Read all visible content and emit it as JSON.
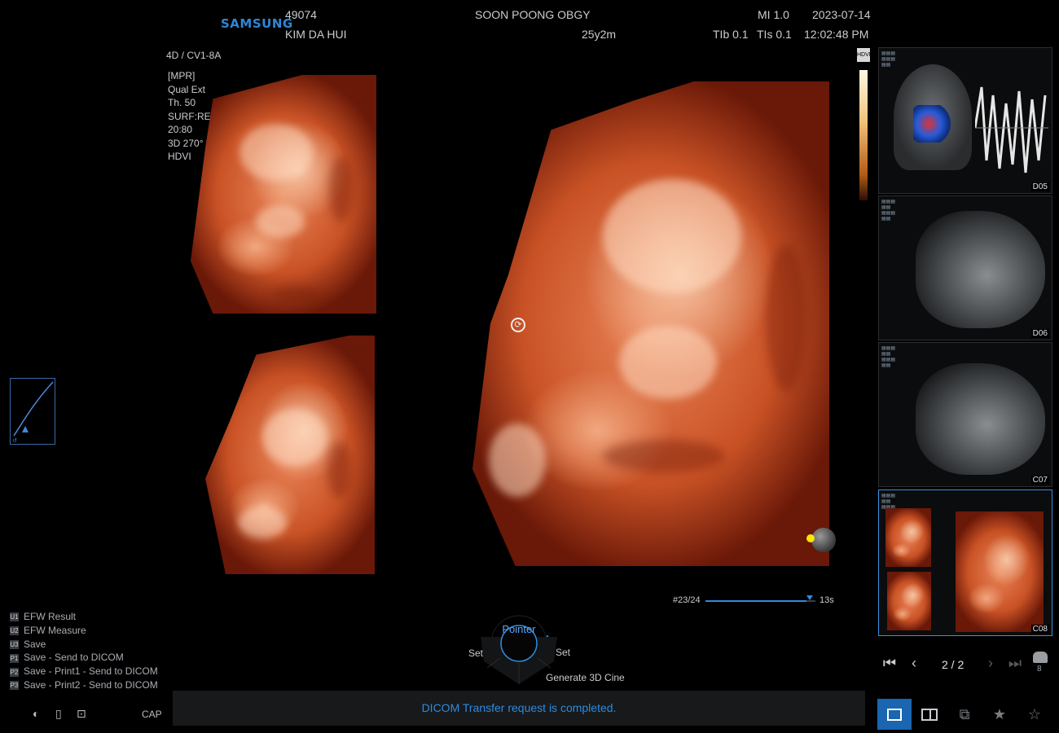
{
  "header": {
    "brand": "SAMSUNG",
    "patient_id": "49074",
    "patient_name": "KIM DA HUI",
    "institution": "SOON POONG OBGY",
    "age": "25y2m",
    "mi": "MI 1.0",
    "tib": "TIb 0.1",
    "tis": "TIs 0.1",
    "date": "2023-07-14",
    "time": "12:02:48 PM"
  },
  "probe": "4D / CV1-8A",
  "params": [
    "[MPR]",
    "Qual Ext",
    "Th. 50",
    "SURF:REAL",
    "20:80",
    "3D 270°",
    "HDVI"
  ],
  "hdvi_tag": "HDVI",
  "cine": {
    "frame": "#23/24",
    "duration": "13s",
    "progress": 0.92
  },
  "wheel": {
    "center_label": "Pointer",
    "left_label": "Set",
    "right_label": "Set",
    "bottom_label": "Generate 3D Cine"
  },
  "menu": [
    {
      "key": "U1",
      "label": "EFW Result"
    },
    {
      "key": "U2",
      "label": "EFW Measure"
    },
    {
      "key": "U3",
      "label": "Save"
    },
    {
      "key": "P1",
      "label": "Save - Send to DICOM"
    },
    {
      "key": "P2",
      "label": "Save - Print1 - Send to DICOM"
    },
    {
      "key": "P3",
      "label": "Save - Print2 - Send to DICOM"
    }
  ],
  "status_message": "DICOM Transfer request is completed.",
  "cap_label": "CAP",
  "thumbnails": [
    {
      "label": "D05"
    },
    {
      "label": "D06"
    },
    {
      "label": "C07"
    },
    {
      "label": "C08"
    }
  ],
  "pager": {
    "text": "2 / 2",
    "count": "8"
  },
  "icons": {
    "first": "skip-first-icon",
    "prev": "chevron-left-icon",
    "next": "chevron-right-icon",
    "last": "skip-last-icon",
    "compare": "compare-icon",
    "layout_single": "single-layout-icon",
    "layout_dual": "dual-layout-icon",
    "star": "star-icon",
    "star_remove": "star-remove-icon"
  },
  "colors": {
    "accent": "#2d8ae0",
    "selected": "#1a66b0",
    "render": "#e98559"
  }
}
